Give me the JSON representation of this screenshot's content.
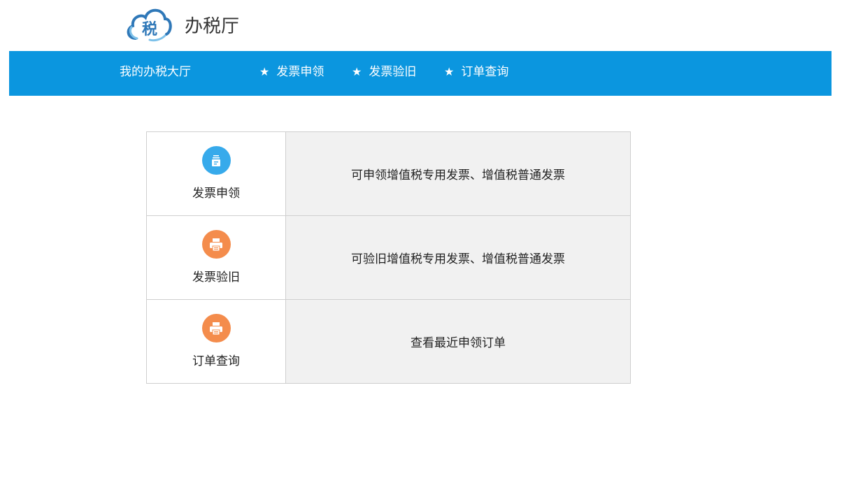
{
  "header": {
    "logo_char": "税",
    "title": "办税厅"
  },
  "nav": {
    "home": "我的办税大厅",
    "items": [
      {
        "label": "发票申领",
        "icon": "star-icon"
      },
      {
        "label": "发票验旧",
        "icon": "star-icon"
      },
      {
        "label": "订单查询",
        "icon": "star-icon"
      }
    ],
    "star": "★"
  },
  "services": [
    {
      "label": "发票申领",
      "description": "可申领增值税专用发票、增值税普通发票",
      "icon": "invoice-apply-icon",
      "color": "#37aaeb"
    },
    {
      "label": "发票验旧",
      "description": "可验旧增值税专用发票、增值税普通发票",
      "icon": "printer-icon",
      "color": "#f48c4c"
    },
    {
      "label": "订单查询",
      "description": "查看最近申领订单",
      "icon": "printer-icon",
      "color": "#f48c4c"
    }
  ],
  "colors": {
    "nav_bg": "#0b96df",
    "cell_bg": "#f1f1f1",
    "border": "#cfcfcf"
  }
}
